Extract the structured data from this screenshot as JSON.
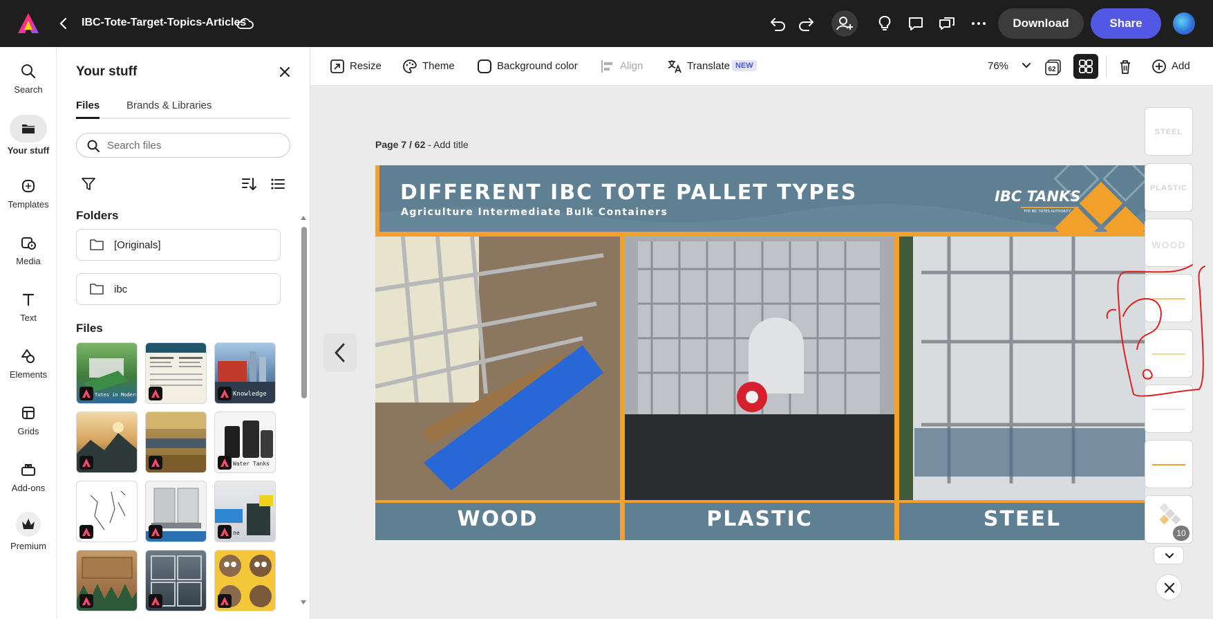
{
  "app": {
    "doc_title": "IBC-Tote-Target-Topics-Articles",
    "download_label": "Download",
    "share_label": "Share"
  },
  "rail": {
    "items": [
      {
        "label": "Search",
        "icon": "search-icon"
      },
      {
        "label": "Your stuff",
        "icon": "folder-icon"
      },
      {
        "label": "Templates",
        "icon": "templates-icon"
      },
      {
        "label": "Media",
        "icon": "media-icon"
      },
      {
        "label": "Text",
        "icon": "text-icon"
      },
      {
        "label": "Elements",
        "icon": "elements-icon"
      },
      {
        "label": "Grids",
        "icon": "grids-icon"
      },
      {
        "label": "Add-ons",
        "icon": "addons-icon"
      },
      {
        "label": "Premium",
        "icon": "crown-icon"
      }
    ]
  },
  "panel": {
    "title": "Your stuff",
    "tabs": [
      "Files",
      "Brands & Libraries"
    ],
    "search_placeholder": "Search files",
    "folders_heading": "Folders",
    "folders": [
      "[Originals]",
      "ibc"
    ],
    "files_heading": "Files",
    "file_captions": [
      "Totes in Modern Farming Practices",
      "",
      "Knowledge",
      "",
      "",
      "Water Tanks",
      "",
      "",
      "ne",
      "",
      "",
      ""
    ]
  },
  "toolbar": {
    "resize": "Resize",
    "theme": "Theme",
    "background_color": "Background color",
    "align": "Align",
    "translate": "Translate",
    "new_badge": "NEW",
    "zoom": "76%",
    "page_count_icon": "62",
    "add": "Add"
  },
  "canvas": {
    "page_label_prefix": "Page 7 / 62",
    "page_label_suffix": " - Add title"
  },
  "slide": {
    "title": "DIFFERENT IBC TOTE PALLET TYPES",
    "subtitle": "Agriculture Intermediate Bulk Containers",
    "brand": "IBC TANKS",
    "brand_tagline": "THE IBC TOTES AUTHORITY",
    "panels": [
      "WOOD",
      "PLASTIC",
      "STEEL"
    ]
  },
  "strip": {
    "labels": [
      "STEEL",
      "PLASTIC",
      "WOOD"
    ],
    "badge": "10"
  },
  "colors": {
    "accent": "#5258e4",
    "slide_orange": "#f2a12b",
    "slide_teal": "#5f7f92",
    "annotation": "#e02020"
  }
}
